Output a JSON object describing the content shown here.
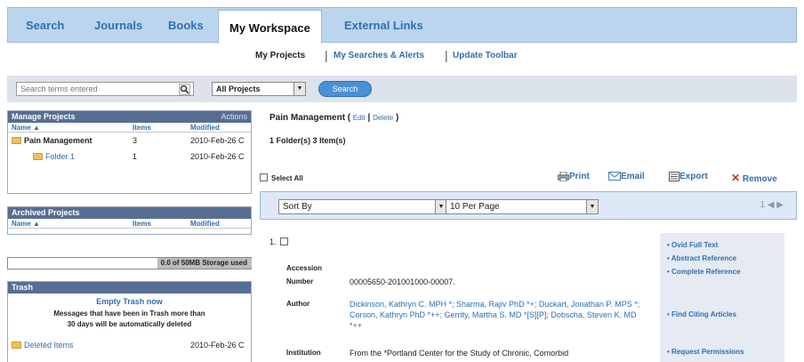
{
  "tabs": [
    "Search",
    "Journals",
    "Books",
    "My Workspace",
    "External Links"
  ],
  "subnav": {
    "projects": "My Projects",
    "searches": "My Searches & Alerts",
    "toolbar": "Update Toolbar"
  },
  "search": {
    "placeholder": "Search terms entered",
    "scope": "All Projects",
    "button": "Search"
  },
  "manage": {
    "title": "Manage Projects",
    "action": "Actions",
    "cols": {
      "name": "Name ▲",
      "items": "Items",
      "modified": "Modified"
    },
    "rows": [
      {
        "name": "Pain Management",
        "items": "3",
        "modified": "2010-Feb-26 C"
      },
      {
        "name": "Folder 1",
        "items": "1",
        "modified": "2010-Feb-26 C"
      }
    ]
  },
  "archived": {
    "title": "Archived Projects",
    "cols": {
      "name": "Name ▲",
      "items": "Items",
      "modified": "Modified"
    }
  },
  "storage": {
    "text": "0.0 of 50MB Storage used",
    "used_fraction": 0.0
  },
  "trash": {
    "title": "Trash",
    "empty": "Empty Trash now",
    "note1": "Messages that have been in Trash more than",
    "note2": "30 days will be automatically deleted",
    "row_name": "Deleted Items",
    "row_date": "2010-Feb-26 C"
  },
  "main": {
    "project": "Pain Management",
    "edit": "Edit",
    "delete": "Delete",
    "counts": "1 Folder(s) 3 Item(s)",
    "select_all": "Select All",
    "actions": {
      "print": "Print",
      "email": "Email",
      "export": "Export",
      "remove": "Remove"
    },
    "sort": "Sort By",
    "per_page": "10 Per Page",
    "pager": "1 ◀ ▶"
  },
  "record": {
    "number": "1.",
    "accession_label_1": "Accession",
    "accession_label_2": "Number",
    "accession": "00005650-201001000-00007.",
    "author_label": "Author",
    "author": "Dickinson, Kathryn C. MPH *; Sharma, Rajiv PhD *+; Duckart, Jonathan P. MPS *; Corson, Kathryn PhD *++; Gerrity, Martha S. MD *[S][P]; Dobscha, Steven K. MD *++",
    "institution_label": "Institution",
    "institution": "From the *Portland Center for the Study of Chronic, Comorbid"
  },
  "side_links": [
    "Ovid Full Text",
    "Abstract Reference",
    "Complete Reference",
    "Find Citing Articles",
    "Request Permissions"
  ],
  "colors": {
    "tabbar": "#bcd5ee",
    "link": "#2f6fb0",
    "panel_header": "#566e94",
    "remove": "#c0392b"
  }
}
